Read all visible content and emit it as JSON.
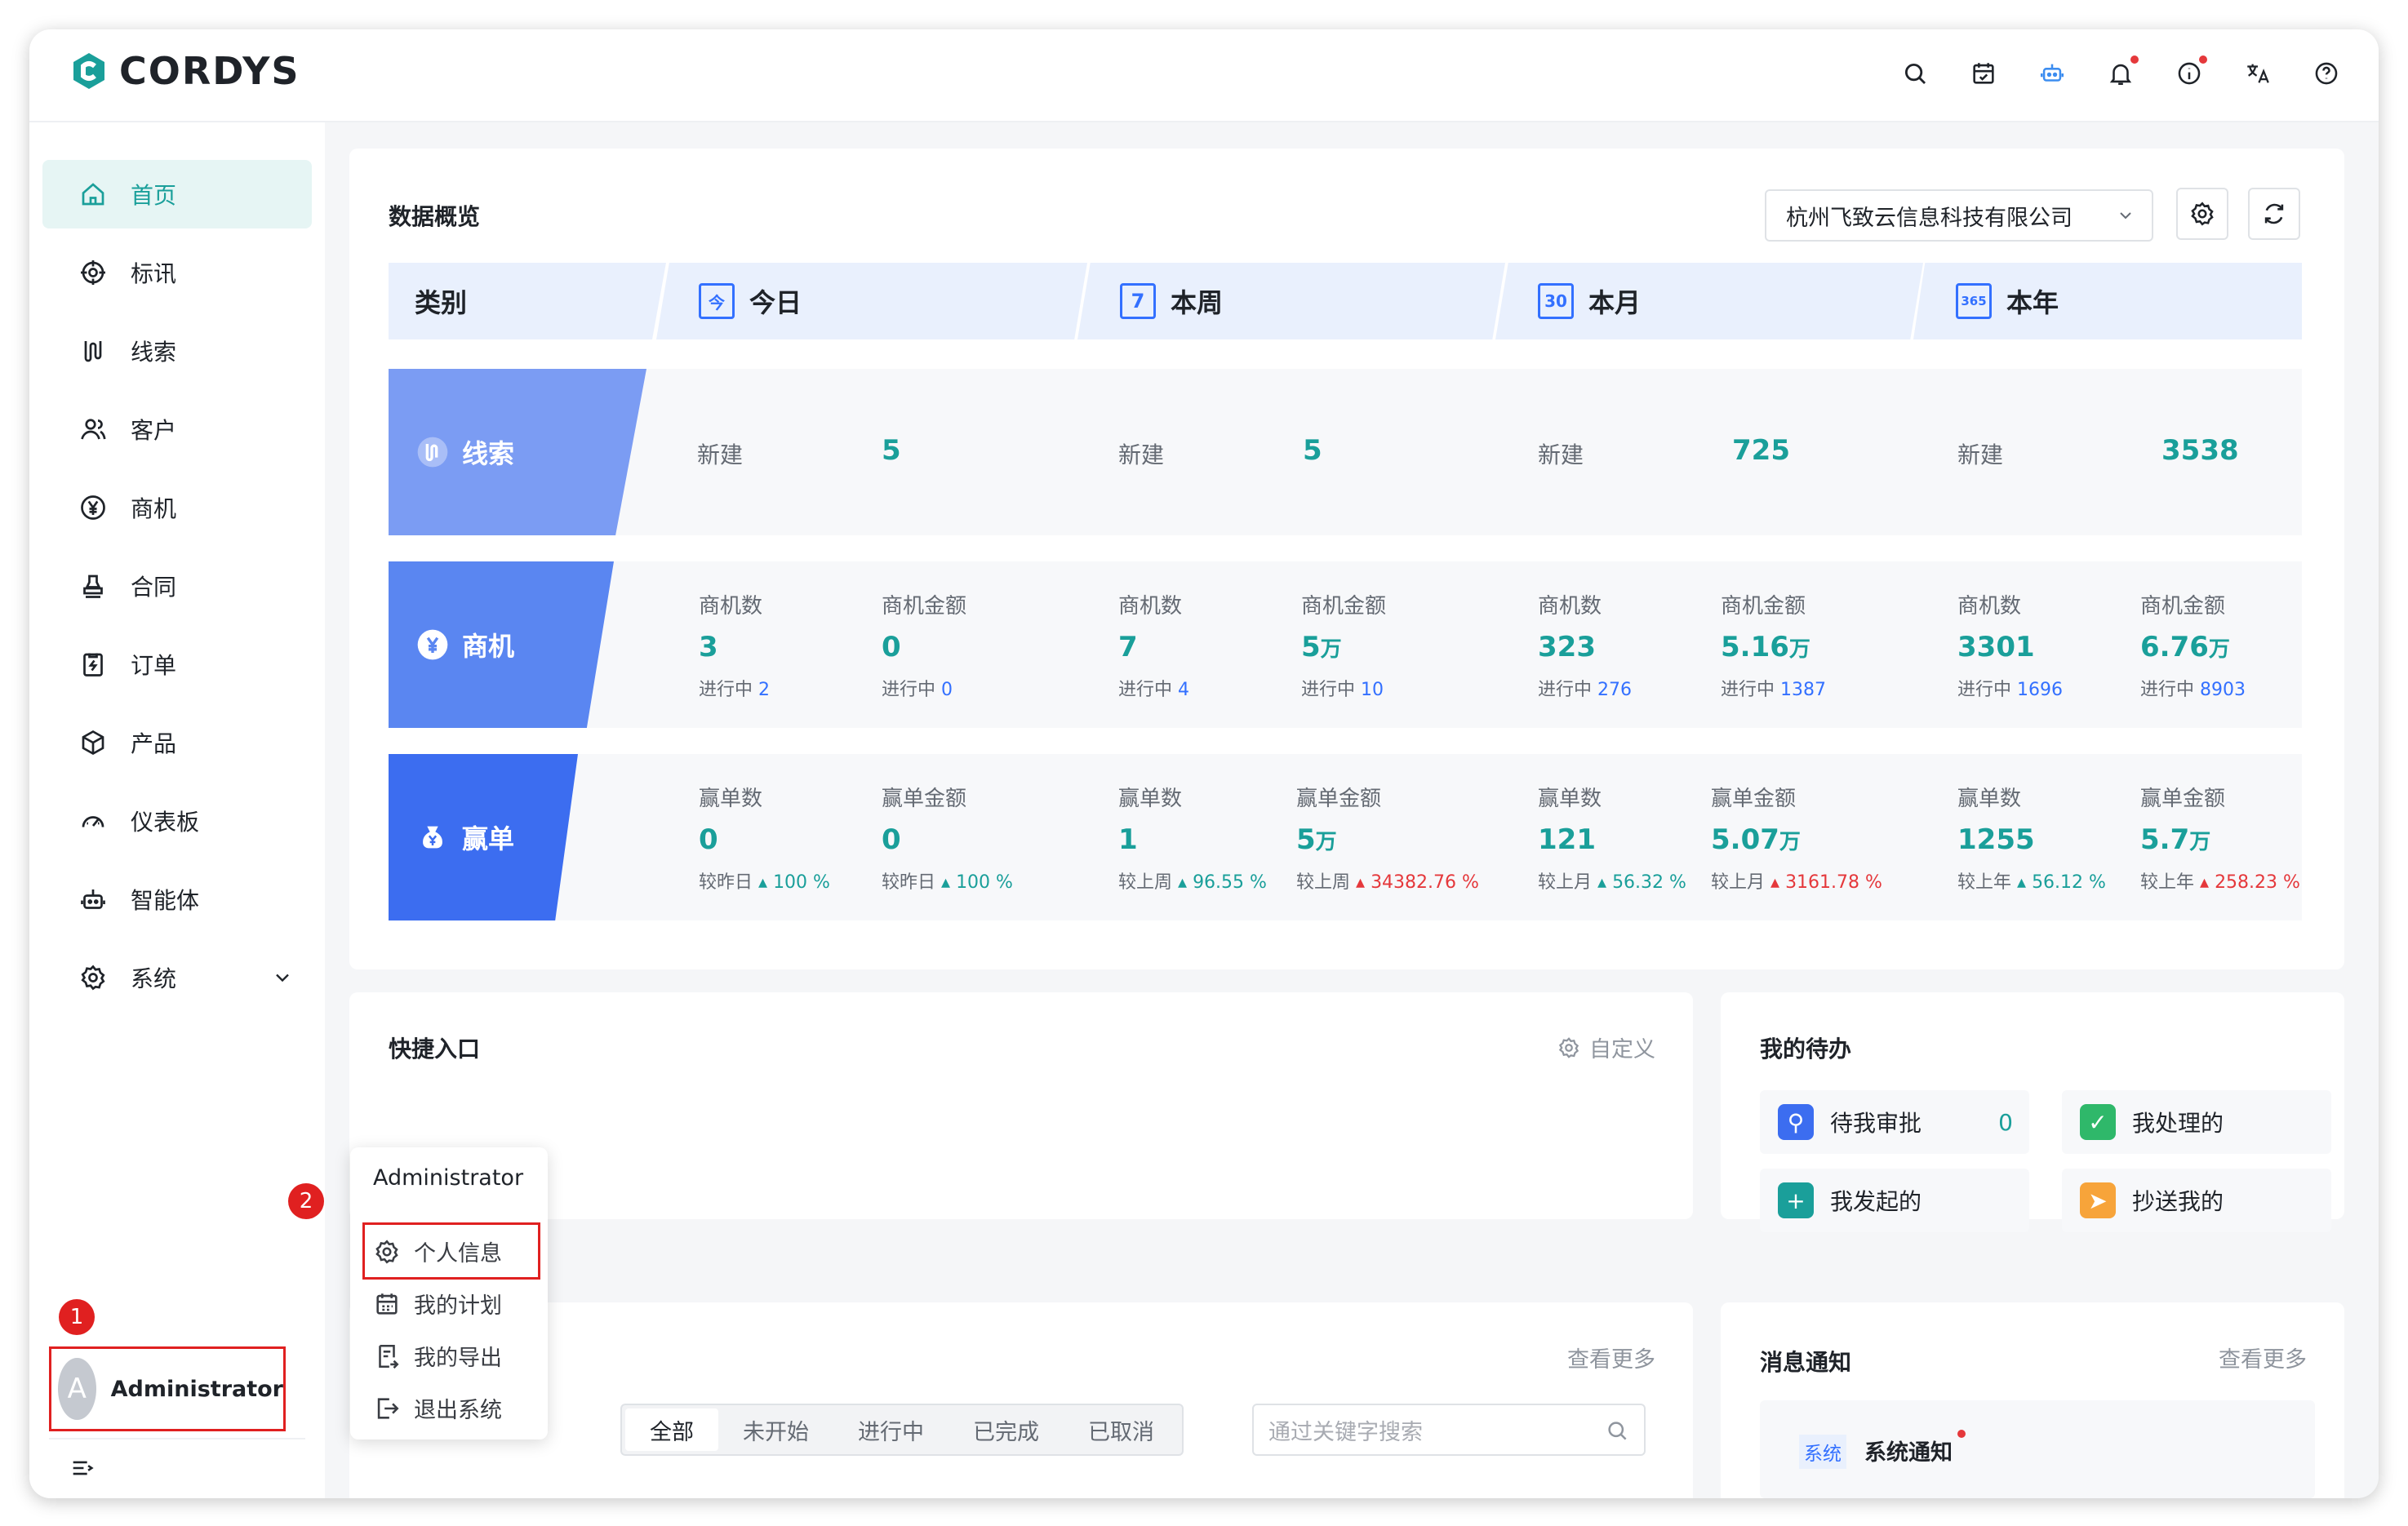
{
  "app": {
    "logo_text": "CORDYS"
  },
  "sidebar": {
    "items": [
      {
        "label": "首页",
        "icon": "home-icon"
      },
      {
        "label": "标讯",
        "icon": "target-icon"
      },
      {
        "label": "线索",
        "icon": "clue-icon"
      },
      {
        "label": "客户",
        "icon": "customer-icon"
      },
      {
        "label": "商机",
        "icon": "yen-icon"
      },
      {
        "label": "合同",
        "icon": "stamp-icon"
      },
      {
        "label": "订单",
        "icon": "order-icon"
      },
      {
        "label": "产品",
        "icon": "cube-icon"
      },
      {
        "label": "仪表板",
        "icon": "dashboard-icon"
      },
      {
        "label": "智能体",
        "icon": "robot-icon"
      },
      {
        "label": "系统",
        "icon": "gear-icon"
      }
    ]
  },
  "user": {
    "avatar_letter": "A",
    "name": "Administrator",
    "step1": "1",
    "step2": "2"
  },
  "overview": {
    "title": "数据概览",
    "org_select": "杭州飞致云信息科技有限公司",
    "header": {
      "category": "类别",
      "today": "今日",
      "week": "本周",
      "month": "本月",
      "year": "本年",
      "today_icon": "今",
      "week_icon": "7",
      "month_icon": "30",
      "year_icon": "365"
    },
    "clue": {
      "label": "线索",
      "new_label": "新建",
      "values": [
        "5",
        "5",
        "725",
        "3538"
      ]
    },
    "opp": {
      "label": "商机",
      "count_label": "商机数",
      "amount_label": "商机金额",
      "progress_label": "进行中",
      "periods": [
        {
          "count": "3",
          "count_prog": "2",
          "amount": "0",
          "amount_unit": "",
          "amount_prog": "0"
        },
        {
          "count": "7",
          "count_prog": "4",
          "amount": "5",
          "amount_unit": "万",
          "amount_prog": "10"
        },
        {
          "count": "323",
          "count_prog": "276",
          "amount": "5.16",
          "amount_unit": "万",
          "amount_prog": "1387"
        },
        {
          "count": "3301",
          "count_prog": "1696",
          "amount": "6.76",
          "amount_unit": "万",
          "amount_prog": "8903"
        }
      ]
    },
    "win": {
      "label": "赢单",
      "count_label": "赢单数",
      "amount_label": "赢单金额",
      "periods": [
        {
          "cmp": "较昨日",
          "count": "0",
          "count_pct": "100 %",
          "count_dir": "up",
          "amount": "0",
          "amount_unit": "",
          "amount_pct": "100 %",
          "amount_dir": "up"
        },
        {
          "cmp": "较上周",
          "count": "1",
          "count_pct": "96.55 %",
          "count_dir": "up",
          "amount": "5",
          "amount_unit": "万",
          "amount_pct": "34382.76 %",
          "amount_dir": "dn"
        },
        {
          "cmp": "较上月",
          "count": "121",
          "count_pct": "56.32 %",
          "count_dir": "up",
          "amount": "5.07",
          "amount_unit": "万",
          "amount_pct": "3161.78 %",
          "amount_dir": "dn"
        },
        {
          "cmp": "较上年",
          "count": "1255",
          "count_pct": "56.12 %",
          "count_dir": "up",
          "amount": "5.7",
          "amount_unit": "万",
          "amount_pct": "258.23 %",
          "amount_dir": "dn"
        }
      ]
    }
  },
  "quick": {
    "title": "快捷入口",
    "customize": "自定义"
  },
  "todo": {
    "title": "我的待办",
    "items": [
      {
        "label": "待我审批",
        "count": "0"
      },
      {
        "label": "我处理的"
      },
      {
        "label": "我发起的"
      },
      {
        "label": "抄送我的"
      }
    ]
  },
  "plan": {
    "more": "查看更多",
    "tabs": [
      "全部",
      "未开始",
      "进行中",
      "已完成",
      "已取消"
    ],
    "search_placeholder": "通过关键字搜索"
  },
  "notice": {
    "title": "消息通知",
    "more": "查看更多",
    "tag": "系统",
    "item": "系统通知"
  },
  "popup": {
    "title": "Administrator",
    "items": [
      "个人信息",
      "我的计划",
      "我的导出",
      "退出系统"
    ]
  },
  "colors": {
    "accent": "#1a9f9a",
    "clue": "#7b9cf3",
    "opp": "#5a86f1",
    "win": "#3c6df0",
    "danger": "#e02020"
  }
}
